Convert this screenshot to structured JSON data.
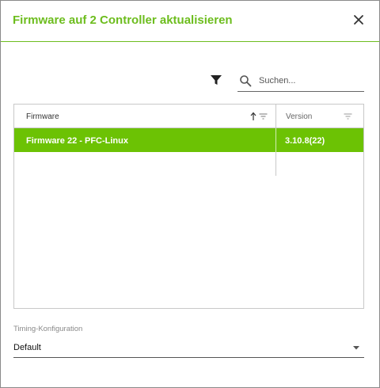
{
  "dialog": {
    "title": "Firmware auf 2 Controller aktualisieren"
  },
  "toolbar": {
    "search_placeholder": "Suchen..."
  },
  "grid": {
    "columns": [
      {
        "label": "Firmware",
        "sort": "ascending"
      },
      {
        "label": "Version"
      }
    ],
    "rows": [
      {
        "firmware": "Firmware 22 - PFC-Linux",
        "version": "3.10.8(22)",
        "selected": true
      }
    ]
  },
  "timing": {
    "label": "Timing-Konfiguration",
    "value": "Default"
  },
  "colors": {
    "accent": "#6dbd1e",
    "selected_row": "#6cc204"
  },
  "icons": [
    "close-icon",
    "filter-icon",
    "search-icon",
    "sort-ascending-icon",
    "column-filter-icon",
    "dropdown-caret-icon"
  ]
}
